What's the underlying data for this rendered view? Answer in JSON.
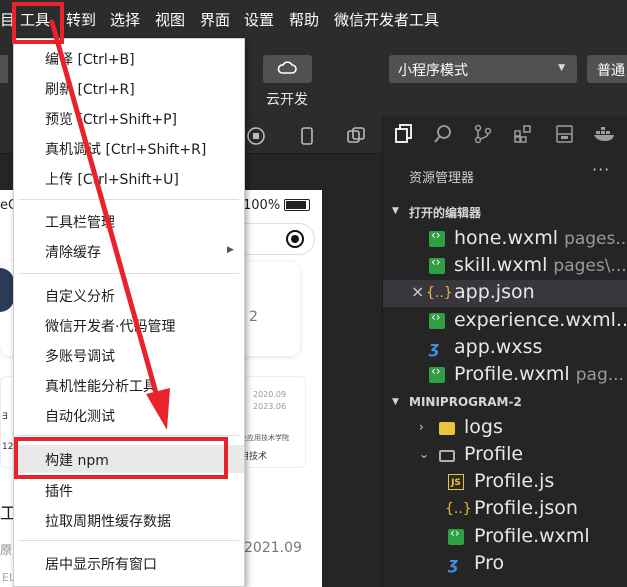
{
  "menubar": {
    "items": [
      "目",
      "工具",
      "转到",
      "选择",
      "视图",
      "界面",
      "设置",
      "帮助",
      "微信开发者工具"
    ]
  },
  "toolbar": {
    "cloud_label": "云开发",
    "mode_select": "小程序模式",
    "compile_select": "普通"
  },
  "phone": {
    "status_left": "eC",
    "battery_pct": "100%",
    "card_number": "2",
    "date1": "2020.09",
    "date2": "2023.06",
    "school_frag": "业应用技术学院",
    "tech_frag": "用技术",
    "left_frag_1": "∃",
    "left_frag_2": "12",
    "big_frag": "工",
    "small_frag": "原",
    "date3": "2021.09",
    "bottom_frag": "EL"
  },
  "explorer": {
    "title": "资源管理器",
    "more": "···",
    "open_editors_header": "打开的编辑器",
    "open_editors": [
      {
        "name": "hone.wxml",
        "path": "pages...",
        "type": "wxml"
      },
      {
        "name": "skill.wxml",
        "path": "pages\\...",
        "type": "wxml"
      },
      {
        "name": "app.json",
        "path": "",
        "type": "json",
        "close": "×"
      },
      {
        "name": "experience.wxml...",
        "path": "",
        "type": "wxml"
      },
      {
        "name": "app.wxss",
        "path": "",
        "type": "wxss"
      },
      {
        "name": "Profile.wxml",
        "path": "pag...",
        "type": "wxml"
      }
    ],
    "project_header": "MINIPROGRAM-2",
    "tree": [
      {
        "name": "logs",
        "type": "folder"
      },
      {
        "name": "Profile",
        "type": "folder-open"
      },
      {
        "name": "Profile.js",
        "type": "js"
      },
      {
        "name": "Profile.json",
        "type": "json"
      },
      {
        "name": "Profile.wxml",
        "type": "wxml"
      },
      {
        "name": "Pro",
        "type": "wxss"
      }
    ]
  },
  "tools_menu": {
    "items": [
      {
        "label": "编译  [Ctrl+B]"
      },
      {
        "label": "刷新  [Ctrl+R]"
      },
      {
        "label": "预览  [Ctrl+Shift+P]"
      },
      {
        "label": "真机调试  [Ctrl+Shift+R]"
      },
      {
        "label": "上传  [Ctrl+Shift+U]"
      },
      {
        "label": "工具栏管理"
      },
      {
        "label": "清除缓存",
        "submenu": "▶"
      },
      {
        "label": "自定义分析"
      },
      {
        "label": "微信开发者·代码管理"
      },
      {
        "label": "多账号调试"
      },
      {
        "label": "真机性能分析工具"
      },
      {
        "label": "自动化测试"
      },
      {
        "label": "构建 npm"
      },
      {
        "label": "插件"
      },
      {
        "label": "拉取周期性缓存数据"
      },
      {
        "label": "居中显示所有窗口"
      }
    ]
  },
  "colors": {
    "annotation_red": "#e8232b",
    "wxml_green": "#2ea043",
    "json_yellow": "#e8b83c",
    "wxss_blue": "#3e8fe0"
  }
}
